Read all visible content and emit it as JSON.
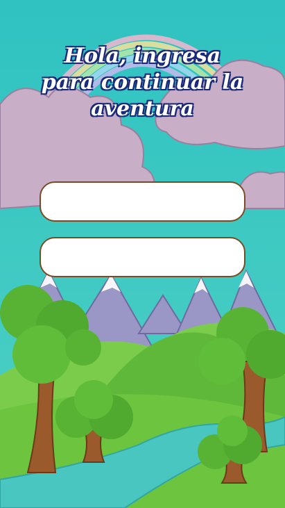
{
  "screen": {
    "title_lines": [
      "Hola, ingresa",
      "para continuar la",
      "aventura"
    ]
  },
  "form": {
    "field1": {
      "value": "",
      "placeholder": ""
    },
    "field2": {
      "value": "",
      "placeholder": ""
    }
  },
  "colors": {
    "sky": "#3cc7c0",
    "field_border": "#7a4a22",
    "title_outline": "#1b2a7a"
  }
}
